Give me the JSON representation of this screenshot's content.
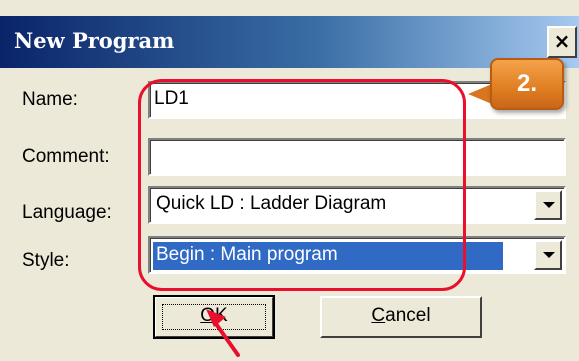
{
  "window": {
    "title": "New Program",
    "close_glyph": "×"
  },
  "form": {
    "name": {
      "label": "Name:",
      "value": "LD1"
    },
    "comment": {
      "label": "Comment:",
      "value": ""
    },
    "language": {
      "label": "Language:",
      "value": "Quick LD : Ladder Diagram"
    },
    "style": {
      "label": "Style:",
      "value": "Begin : Main program"
    }
  },
  "buttons": {
    "ok": {
      "mnemonic": "O",
      "rest": "K"
    },
    "cancel": {
      "mnemonic": "C",
      "rest": "ancel"
    }
  },
  "annotation": {
    "step": "2."
  },
  "colors": {
    "title_bar": "#0a246a",
    "selection": "#316ac5",
    "highlight": "#e8102c",
    "badge": "#e07e22"
  }
}
